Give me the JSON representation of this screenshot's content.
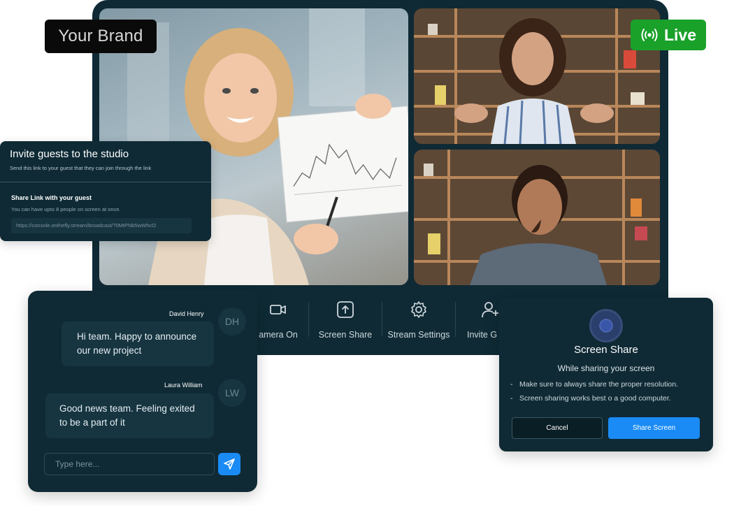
{
  "brand": {
    "label": "Your Brand"
  },
  "live": {
    "label": "Live",
    "color": "#1aa12a"
  },
  "invite": {
    "title": "Invite guests to the studio",
    "subtitle": "Send this link to your guest that they can join through the link",
    "share_label": "Share Link with your guest",
    "hint": "You can have upto 8 people on screen at once.",
    "link": "https://console.onthefly.stream/broadcast/?0MtPNb5wWhcO"
  },
  "controls": [
    {
      "label": "amera On",
      "icon": "camera-icon"
    },
    {
      "label": "Screen Share",
      "icon": "screen-share-icon"
    },
    {
      "label": "Stream Settings",
      "icon": "gear-icon"
    },
    {
      "label": "Invite G",
      "icon": "add-user-icon"
    }
  ],
  "chat": {
    "messages": [
      {
        "author": "David Henry",
        "initials": "DH",
        "text_line1": "Hi team. Happy to announce",
        "text_line2": "our new project"
      },
      {
        "author": "Laura William",
        "initials": "LW",
        "text_line1": "Good news team. Feeling exited",
        "text_line2": "to be a part of it"
      }
    ],
    "placeholder": "Type here..."
  },
  "screen_share": {
    "title": "Screen Share",
    "subtitle": "While sharing your screen",
    "tips": [
      "Make sure to always share the proper resolution.",
      "Screen sharing works best o a good computer."
    ],
    "cancel_label": "Cancel",
    "confirm_label": "Share Screen",
    "accent": "#1a8bf5"
  },
  "colors": {
    "panel": "#0f2a35",
    "panel_light": "#163541",
    "accent": "#1a8bf5"
  }
}
